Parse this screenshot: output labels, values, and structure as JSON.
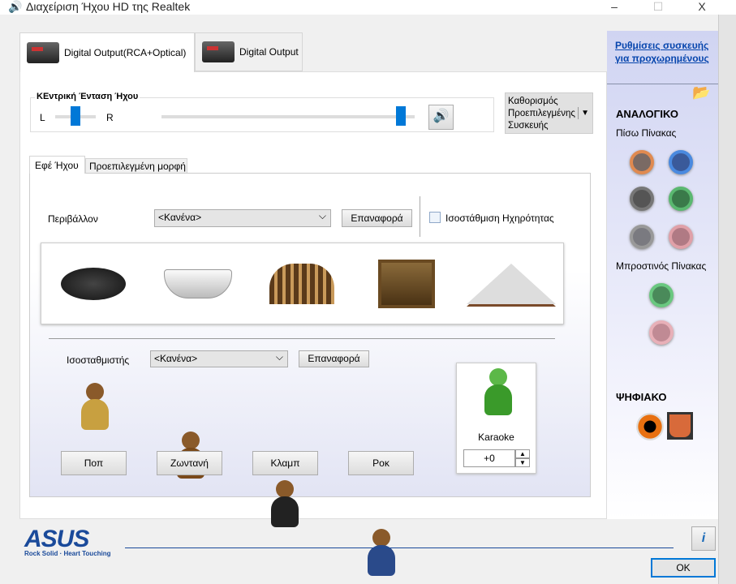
{
  "window": {
    "title": "Διαχείριση Ήχου HD της Realtek",
    "minimize": "–",
    "maximize": "☐",
    "close": "X"
  },
  "device_tabs": [
    {
      "label": "Digital Output(RCA+Optical)"
    },
    {
      "label": "Digital Output"
    }
  ],
  "volume": {
    "group_label": "ΚΕντρική Ένταση Ήχου",
    "left_label": "L",
    "right_label": "R",
    "balance": 0.5,
    "level": 0.95
  },
  "default_device": {
    "label": "Καθορισμός Προεπιλεγμένης Συσκευής"
  },
  "sub_tabs": [
    {
      "label": "Εφέ Ήχου"
    },
    {
      "label": "Προεπιλεγμένη μορφή"
    }
  ],
  "environment": {
    "label": "Περιβάλλον",
    "value": "<Κανένα>",
    "reset": "Επαναφορά",
    "loudness_label": "Ισοστάθμιση Ηχηρότητας",
    "loudness_checked": false
  },
  "equalizer": {
    "label": "Ισοσταθμιστής",
    "value": "<Κανένα>",
    "reset": "Επαναφορά",
    "presets": [
      {
        "label": "Ποπ"
      },
      {
        "label": "Ζωντανή"
      },
      {
        "label": "Κλαμπ"
      },
      {
        "label": "Ροκ"
      }
    ]
  },
  "karaoke": {
    "label": "Karaoke",
    "value": "+0"
  },
  "sidebar": {
    "advanced_link": "Ρυθμίσεις συσκευής για προχωρημένους",
    "analog": "ΑΝΑΛΟΓΙΚΟ",
    "back_panel": "Πίσω Πίνακας",
    "front_panel": "Μπροστινός Πίνακας",
    "digital": "ΨΗΦΙΑΚΟ"
  },
  "footer": {
    "brand": "ASUS",
    "tagline": "Rock Solid · Heart Touching",
    "ok": "OK",
    "info": "i"
  },
  "colors": {
    "accent": "#0078d7",
    "link": "#0645ad"
  }
}
